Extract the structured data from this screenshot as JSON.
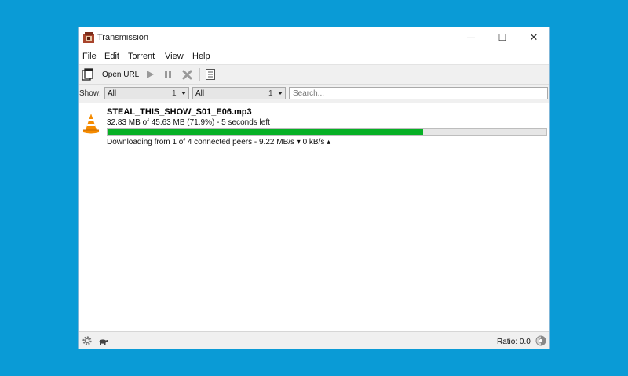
{
  "window": {
    "title": "Transmission",
    "controls": {
      "minimize": "—",
      "maximize": "☐",
      "close": "✕"
    }
  },
  "menu": [
    "File",
    "Edit",
    "Torrent",
    "View",
    "Help"
  ],
  "toolbar": {
    "open_url_label": "Open URL",
    "icons": [
      "open-file-icon",
      "play-icon",
      "pause-icon",
      "remove-icon",
      "properties-icon"
    ]
  },
  "filter": {
    "show_label": "Show:",
    "activity": {
      "value": "All",
      "count": "1"
    },
    "tracker": {
      "value": "All",
      "count": "1"
    },
    "search_placeholder": "Search..."
  },
  "torrents": [
    {
      "name": "STEAL_THIS_SHOW_S01_E06.mp3",
      "progress_text": "32.83 MB of 45.63 MB (71.9%) - 5 seconds left",
      "progress": 0.719,
      "status": "Downloading from 1 of 4 connected peers - 9.22 MB/s ▾ 0 kB/s ▴",
      "icon": "vlc-cone-icon",
      "progress_color": "#06b025"
    }
  ],
  "statusbar": {
    "ratio_text": "Ratio: 0.0",
    "icons": [
      "settings-gear-icon",
      "turtle-icon",
      "ratio-icon"
    ]
  },
  "colors": {
    "background": "#0a9bd6",
    "accent": "#06b025"
  }
}
